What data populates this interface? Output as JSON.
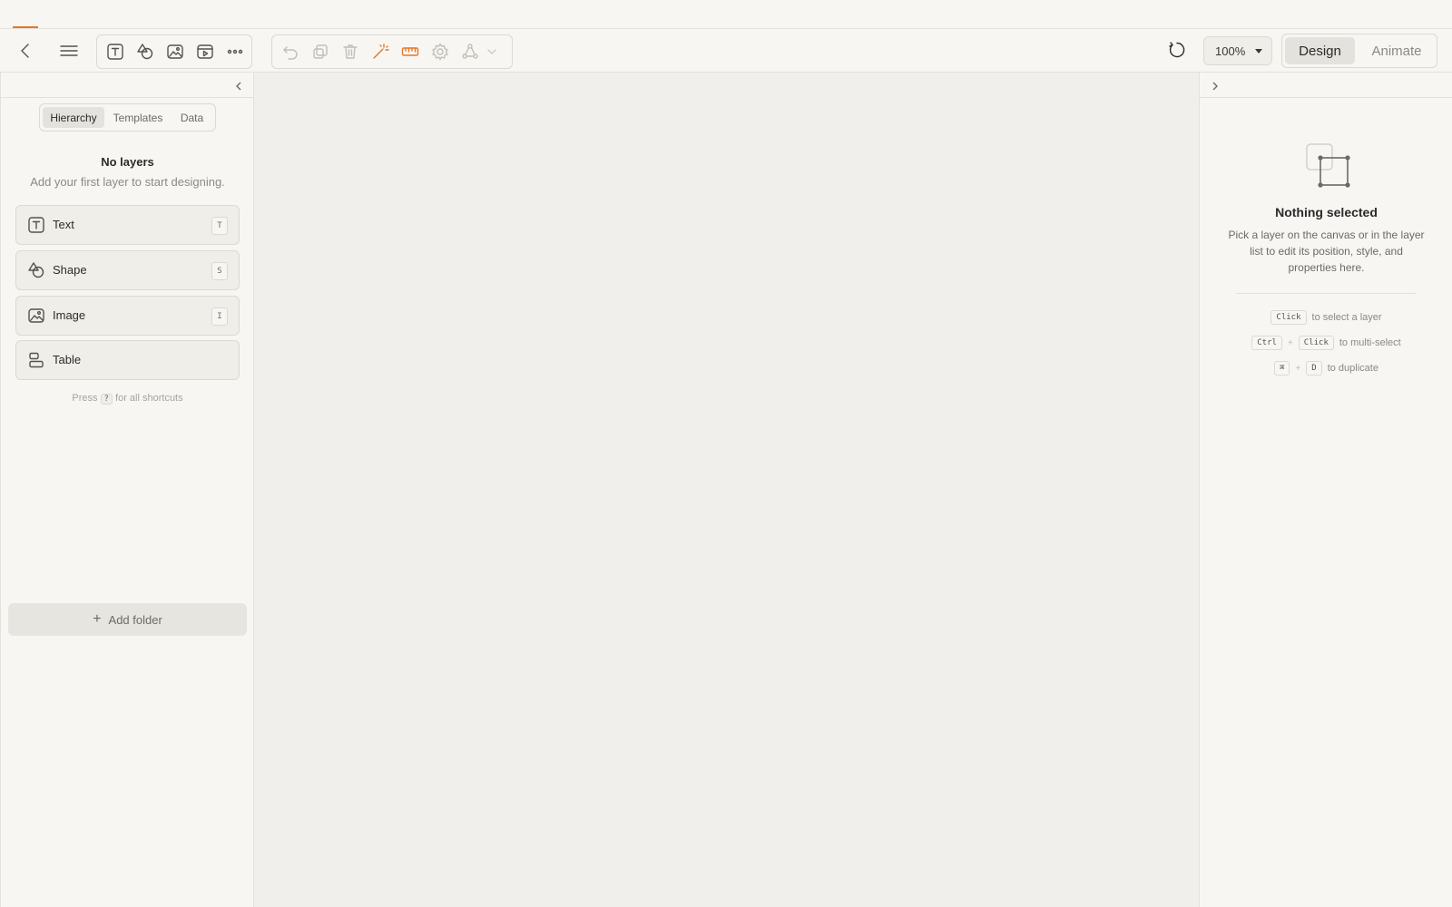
{
  "toolbar": {
    "zoom": "100%",
    "modes": {
      "design": "Design",
      "animate": "Animate"
    },
    "accent_color": "#e5762a"
  },
  "left_panel": {
    "tabs": [
      "Hierarchy",
      "Templates",
      "Data"
    ],
    "empty_title": "No layers",
    "empty_subtitle": "Add your first layer to start designing.",
    "layer_types": [
      {
        "label": "Text",
        "shortcut": "T",
        "icon": "text-icon"
      },
      {
        "label": "Shape",
        "shortcut": "S",
        "icon": "shape-icon"
      },
      {
        "label": "Image",
        "shortcut": "I",
        "icon": "image-icon"
      },
      {
        "label": "Table",
        "shortcut": "",
        "icon": "table-icon"
      }
    ],
    "hint_prefix": "Press",
    "hint_key": "?",
    "hint_suffix": "for all shortcuts",
    "add_folder": "Add folder"
  },
  "right_panel": {
    "title": "Nothing selected",
    "subtitle": "Pick a layer on the canvas or in the layer list to edit its position, style, and properties here.",
    "hints": [
      {
        "keys": [
          "Click"
        ],
        "text": "to select a layer"
      },
      {
        "keys": [
          "Ctrl",
          "Click"
        ],
        "text": "to multi-select"
      },
      {
        "keys": [
          "⌘",
          "D"
        ],
        "text": "to duplicate"
      }
    ]
  }
}
